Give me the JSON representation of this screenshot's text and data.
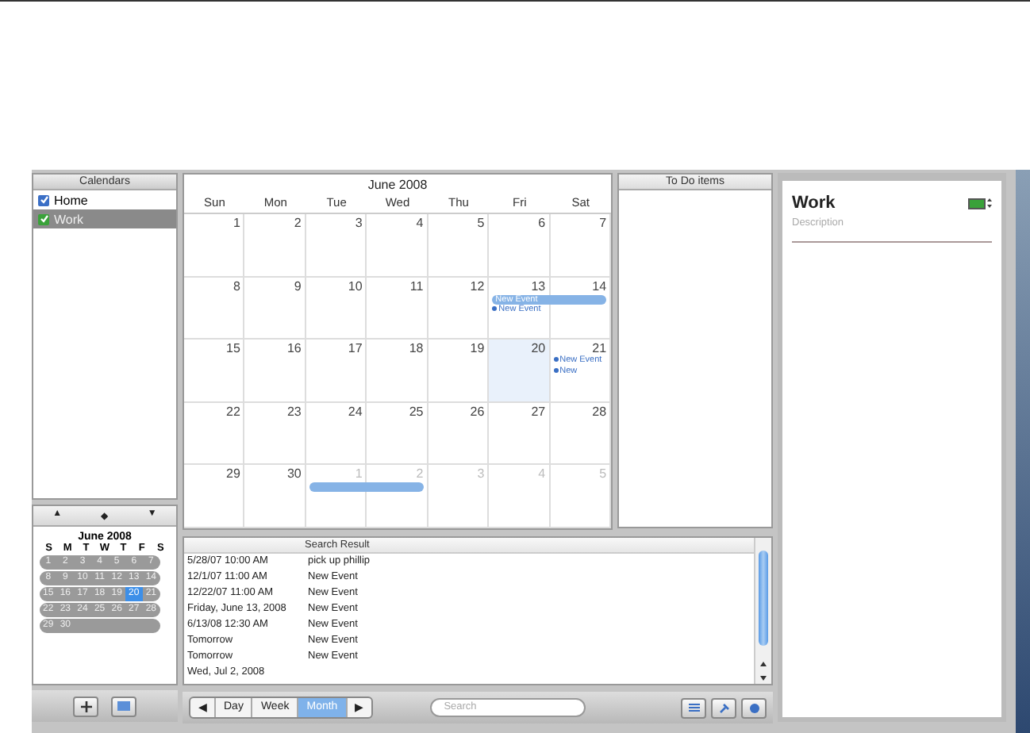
{
  "calendars": {
    "header": "Calendars",
    "items": [
      {
        "label": "Home",
        "checked": true,
        "selected": false,
        "color": "#3b6fc6"
      },
      {
        "label": "Work",
        "checked": true,
        "selected": true,
        "color": "#3aa23a"
      }
    ]
  },
  "mini_calendar": {
    "nav": [
      "▲",
      "◆",
      "▼"
    ],
    "title": "June 2008",
    "weekdays": [
      "S",
      "M",
      "T",
      "W",
      "T",
      "F",
      "S"
    ],
    "weeks": [
      [
        {
          "day": "1",
          "selected": false
        },
        {
          "day": "2",
          "selected": false
        },
        {
          "day": "3",
          "selected": false
        },
        {
          "day": "4",
          "selected": false
        },
        {
          "day": "5",
          "selected": false
        },
        {
          "day": "6",
          "selected": false
        },
        {
          "day": "7",
          "selected": false
        }
      ],
      [
        {
          "day": "8",
          "selected": false
        },
        {
          "day": "9",
          "selected": false
        },
        {
          "day": "10",
          "selected": false
        },
        {
          "day": "11",
          "selected": false
        },
        {
          "day": "12",
          "selected": false
        },
        {
          "day": "13",
          "selected": false
        },
        {
          "day": "14",
          "selected": false
        }
      ],
      [
        {
          "day": "15",
          "selected": false
        },
        {
          "day": "16",
          "selected": false
        },
        {
          "day": "17",
          "selected": false
        },
        {
          "day": "18",
          "selected": false
        },
        {
          "day": "19",
          "selected": false
        },
        {
          "day": "20",
          "selected": true
        },
        {
          "day": "21",
          "selected": false
        }
      ],
      [
        {
          "day": "22",
          "selected": false
        },
        {
          "day": "23",
          "selected": false
        },
        {
          "day": "24",
          "selected": false
        },
        {
          "day": "25",
          "selected": false
        },
        {
          "day": "26",
          "selected": false
        },
        {
          "day": "27",
          "selected": false
        },
        {
          "day": "28",
          "selected": false
        }
      ],
      [
        {
          "day": "29",
          "selected": false
        },
        {
          "day": "30",
          "selected": false
        }
      ]
    ]
  },
  "month_view": {
    "title": "June 2008",
    "weekdays": [
      "Sun",
      "Mon",
      "Tue",
      "Wed",
      "Thu",
      "Fri",
      "Sat"
    ],
    "weeks": [
      [
        {
          "day": "1",
          "other_month": false,
          "today": false
        },
        {
          "day": "2",
          "other_month": false,
          "today": false
        },
        {
          "day": "3",
          "other_month": false,
          "today": false
        },
        {
          "day": "4",
          "other_month": false,
          "today": false
        },
        {
          "day": "5",
          "other_month": false,
          "today": false
        },
        {
          "day": "6",
          "other_month": false,
          "today": false
        },
        {
          "day": "7",
          "other_month": false,
          "today": false
        }
      ],
      [
        {
          "day": "8",
          "other_month": false,
          "today": false
        },
        {
          "day": "9",
          "other_month": false,
          "today": false
        },
        {
          "day": "10",
          "other_month": false,
          "today": false
        },
        {
          "day": "11",
          "other_month": false,
          "today": false
        },
        {
          "day": "12",
          "other_month": false,
          "today": false
        },
        {
          "day": "13",
          "other_month": false,
          "today": false,
          "events": [
            {
              "kind": "banner-start",
              "label": "New Event"
            },
            {
              "kind": "item",
              "label": "New Event"
            }
          ]
        },
        {
          "day": "14",
          "other_month": false,
          "today": false,
          "events": [
            {
              "kind": "banner-end"
            }
          ]
        }
      ],
      [
        {
          "day": "15",
          "other_month": false,
          "today": false
        },
        {
          "day": "16",
          "other_month": false,
          "today": false
        },
        {
          "day": "17",
          "other_month": false,
          "today": false
        },
        {
          "day": "18",
          "other_month": false,
          "today": false
        },
        {
          "day": "19",
          "other_month": false,
          "today": false
        },
        {
          "day": "20",
          "other_month": false,
          "today": true
        },
        {
          "day": "21",
          "other_month": false,
          "today": false,
          "events": [
            {
              "kind": "item",
              "label": "New Event"
            },
            {
              "kind": "item",
              "label": "New"
            }
          ]
        }
      ],
      [
        {
          "day": "22",
          "other_month": false,
          "today": false
        },
        {
          "day": "23",
          "other_month": false,
          "today": false
        },
        {
          "day": "24",
          "other_month": false,
          "today": false
        },
        {
          "day": "25",
          "other_month": false,
          "today": false
        },
        {
          "day": "26",
          "other_month": false,
          "today": false
        },
        {
          "day": "27",
          "other_month": false,
          "today": false
        },
        {
          "day": "28",
          "other_month": false,
          "today": false
        }
      ],
      [
        {
          "day": "29",
          "other_month": false,
          "today": false
        },
        {
          "day": "30",
          "other_month": false,
          "today": false
        },
        {
          "day": "1",
          "other_month": true,
          "today": false,
          "events": [
            {
              "kind": "banner-start"
            }
          ]
        },
        {
          "day": "2",
          "other_month": true,
          "today": false,
          "events": [
            {
              "kind": "banner-end"
            }
          ]
        },
        {
          "day": "3",
          "other_month": true,
          "today": false
        },
        {
          "day": "4",
          "other_month": true,
          "today": false
        },
        {
          "day": "5",
          "other_month": true,
          "today": false
        }
      ]
    ]
  },
  "search_results": {
    "column_2": "Search Result",
    "rows": [
      {
        "date": "5/28/07 10:00 AM",
        "title": "pick up phillip"
      },
      {
        "date": "12/1/07 11:00 AM",
        "title": "New Event"
      },
      {
        "date": "12/22/07 11:00 AM",
        "title": "New Event"
      },
      {
        "date": "Friday, June 13, 2008",
        "title": "New Event"
      },
      {
        "date": "6/13/08 12:30 AM",
        "title": "New Event"
      },
      {
        "date": "Tomorrow",
        "title": "New Event"
      },
      {
        "date": "Tomorrow",
        "title": "New Event"
      },
      {
        "date": "Wed, Jul 2, 2008"
      }
    ]
  },
  "todo": {
    "header": "To Do items"
  },
  "info": {
    "title": "Work",
    "color": "#3aa23a",
    "description_placeholder": "Description"
  },
  "toolbar": {
    "prev": "◀",
    "next": "▶",
    "views": [
      {
        "label": "Day",
        "selected": false
      },
      {
        "label": "Week",
        "selected": false
      },
      {
        "label": "Month",
        "selected": true
      }
    ],
    "search_placeholder": "Search"
  }
}
